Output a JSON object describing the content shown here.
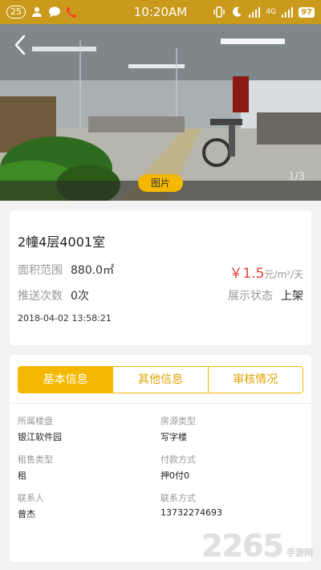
{
  "statusbar": {
    "notif_count": "25",
    "time": "10:20AM",
    "network": "4G",
    "battery": "97"
  },
  "hero": {
    "image_badge": "图片",
    "counter": "1/3"
  },
  "info": {
    "title": "2幢4层4001室",
    "area_label": "面积范围",
    "area_value": "880.0㎡",
    "price_symbol": "￥",
    "price_value": "1.5",
    "price_unit": "元/m²/天",
    "push_label": "推送次数",
    "push_value": "0次",
    "display_label": "展示状态",
    "display_value": "上架",
    "date": "2018-04-02 13:58:21"
  },
  "tabs": [
    {
      "label": "基本信息",
      "active": true
    },
    {
      "label": "其他信息",
      "active": false
    },
    {
      "label": "审核情况",
      "active": false
    }
  ],
  "details": {
    "building_label": "所属楼盘",
    "building_value": "银江软件园",
    "type_label": "房源类型",
    "type_value": "写字楼",
    "rent_label": "租售类型",
    "rent_value": "租",
    "pay_label": "付款方式",
    "pay_value": "押0付0",
    "contact_label": "联系人",
    "contact_value": "曾杰",
    "phone_label": "联系方式",
    "phone_value": "13732274693"
  },
  "watermark": {
    "number": "2265",
    "text": "手游网"
  },
  "colors": {
    "accent": "#f5b800",
    "statusbar": "#c99a1c",
    "price": "#e6433a"
  }
}
